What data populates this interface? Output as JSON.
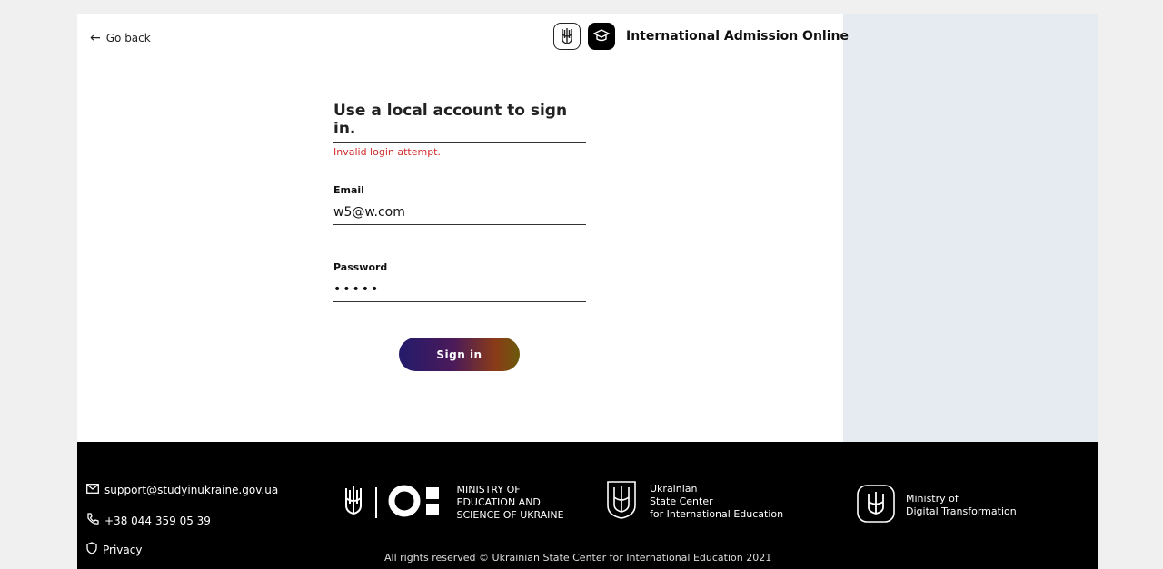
{
  "header": {
    "back_label": "Go back",
    "brand_title": "International Admission Online"
  },
  "form": {
    "title": "Use a local account to sign in.",
    "error": "Invalid login attempt.",
    "email_label": "Email",
    "email_value": "w5@w.com",
    "password_label": "Password",
    "password_value": "•••••",
    "submit_label": "Sign in"
  },
  "footer": {
    "email": "support@studyinukraine.gov.ua",
    "phone": "+38 044 359 05 39",
    "privacy": "Privacy",
    "ministry_education": [
      "MINISTRY OF",
      "EDUCATION AND",
      "SCIENCE OF UKRAINE"
    ],
    "state_center": [
      "Ukrainian",
      "State Center",
      "for International Education"
    ],
    "digital": [
      "Ministry of",
      "Digital Transformation"
    ],
    "copyright": "All rights reserved © Ukrainian State Center for International Education 2021"
  },
  "colors": {
    "error": "#d22c2c",
    "side_panel": "#e6ebf2",
    "footer": "#000000"
  }
}
